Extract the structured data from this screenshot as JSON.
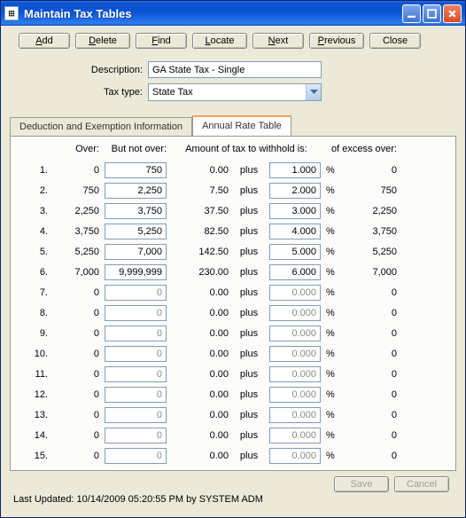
{
  "window": {
    "title": "Maintain Tax Tables"
  },
  "toolbar": {
    "add": "Add",
    "delete": "Delete",
    "find": "Find",
    "locate": "Locate",
    "next": "Next",
    "previous": "Previous",
    "close": "Close"
  },
  "form": {
    "description_label": "Description:",
    "description_value": "GA State Tax - Single",
    "taxtype_label": "Tax type:",
    "taxtype_value": "State Tax"
  },
  "tabs": {
    "deduction": "Deduction and Exemption Information",
    "annual": "Annual Rate Table"
  },
  "grid": {
    "headers": {
      "over": "Over:",
      "but_not_over": "But not over:",
      "amount": "Amount of tax to withhold is:",
      "excess": "of excess over:"
    },
    "plus": "plus",
    "pct": "%",
    "rows": [
      {
        "idx": "1.",
        "over": "0",
        "but": "750",
        "amt": "0.00",
        "rate": "1.000",
        "exc": "0",
        "active": true
      },
      {
        "idx": "2.",
        "over": "750",
        "but": "2,250",
        "amt": "7.50",
        "rate": "2.000",
        "exc": "750",
        "active": true
      },
      {
        "idx": "3.",
        "over": "2,250",
        "but": "3,750",
        "amt": "37.50",
        "rate": "3.000",
        "exc": "2,250",
        "active": true
      },
      {
        "idx": "4.",
        "over": "3,750",
        "but": "5,250",
        "amt": "82.50",
        "rate": "4.000",
        "exc": "3,750",
        "active": true
      },
      {
        "idx": "5.",
        "over": "5,250",
        "but": "7,000",
        "amt": "142.50",
        "rate": "5.000",
        "exc": "5,250",
        "active": true
      },
      {
        "idx": "6.",
        "over": "7,000",
        "but": "9,999,999",
        "amt": "230.00",
        "rate": "6.000",
        "exc": "7,000",
        "active": true
      },
      {
        "idx": "7.",
        "over": "0",
        "but": "0",
        "amt": "0.00",
        "rate": "0.000",
        "exc": "0",
        "active": false
      },
      {
        "idx": "8.",
        "over": "0",
        "but": "0",
        "amt": "0.00",
        "rate": "0.000",
        "exc": "0",
        "active": false
      },
      {
        "idx": "9.",
        "over": "0",
        "but": "0",
        "amt": "0.00",
        "rate": "0.000",
        "exc": "0",
        "active": false
      },
      {
        "idx": "10.",
        "over": "0",
        "but": "0",
        "amt": "0.00",
        "rate": "0.000",
        "exc": "0",
        "active": false
      },
      {
        "idx": "11.",
        "over": "0",
        "but": "0",
        "amt": "0.00",
        "rate": "0.000",
        "exc": "0",
        "active": false
      },
      {
        "idx": "12.",
        "over": "0",
        "but": "0",
        "amt": "0.00",
        "rate": "0.000",
        "exc": "0",
        "active": false
      },
      {
        "idx": "13.",
        "over": "0",
        "but": "0",
        "amt": "0.00",
        "rate": "0.000",
        "exc": "0",
        "active": false
      },
      {
        "idx": "14.",
        "over": "0",
        "but": "0",
        "amt": "0.00",
        "rate": "0.000",
        "exc": "0",
        "active": false
      },
      {
        "idx": "15.",
        "over": "0",
        "but": "0",
        "amt": "0.00",
        "rate": "0.000",
        "exc": "0",
        "active": false
      }
    ]
  },
  "footer": {
    "save": "Save",
    "cancel": "Cancel"
  },
  "status": "Last Updated: 10/14/2009 05:20:55 PM by SYSTEM ADM"
}
